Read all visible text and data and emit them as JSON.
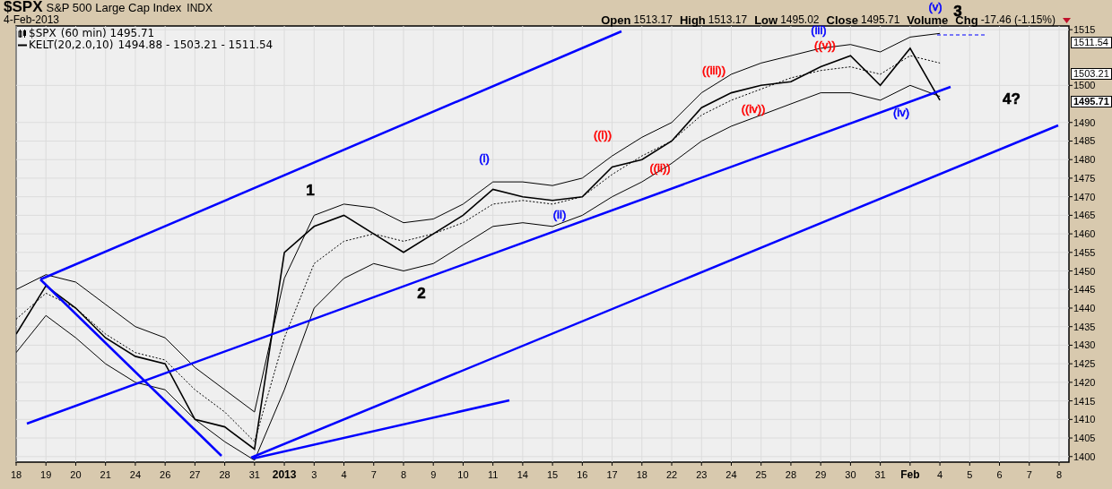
{
  "header": {
    "symbol": "$SPX",
    "name": "S&P 500 Large Cap Index",
    "exchange": "INDX",
    "date": "4-Feb-2013",
    "quote": [
      {
        "label": "Open",
        "value": "1513.17"
      },
      {
        "label": "High",
        "value": "1513.17"
      },
      {
        "label": "Low",
        "value": "1495.02"
      },
      {
        "label": "Close",
        "value": "1495.71"
      },
      {
        "label": "Volume"
      },
      {
        "label": "Chg",
        "value": "-17.46 (-1.15%)"
      }
    ]
  },
  "legend": [
    {
      "kind": "price",
      "text": "(60 min) 1495.71"
    },
    {
      "kind": "indicator",
      "text": "1494.88 - 1503.21 - 1511.54"
    }
  ],
  "price_tags": [
    {
      "text": "1511.54",
      "bold": false
    },
    {
      "text": "1503.21",
      "bold": false
    },
    {
      "text": "1495.71",
      "bold": true
    }
  ],
  "wave_labels": [
    {
      "text": "1",
      "color": "#000000"
    },
    {
      "text": "2",
      "color": "#000000"
    },
    {
      "text": "3",
      "color": "#000000"
    },
    {
      "text": "4?",
      "color": "#000000"
    },
    {
      "text": "(i)",
      "color": "#0000ff"
    },
    {
      "text": "(ii)",
      "color": "#0000ff"
    },
    {
      "text": "(iii)",
      "color": "#0000ff"
    },
    {
      "text": "(iv)",
      "color": "#0000ff"
    },
    {
      "text": "(v)",
      "color": "#0000ff"
    },
    {
      "text": "((i))",
      "color": "#ff0000"
    },
    {
      "text": "((ii))",
      "color": "#ff0000"
    },
    {
      "text": "((iii))",
      "color": "#ff0000"
    },
    {
      "text": "((iv))",
      "color": "#ff0000"
    },
    {
      "text": "((v))",
      "color": "#ff0000"
    }
  ],
  "chart_data": {
    "type": "line",
    "grid": true,
    "categories": [
      "18",
      "19",
      "20",
      "21",
      "24",
      "26",
      "27",
      "28",
      "31",
      "2013",
      "3",
      "4",
      "7",
      "8",
      "9",
      "10",
      "11",
      "14",
      "15",
      "16",
      "17",
      "18",
      "22",
      "23",
      "24",
      "25",
      "28",
      "29",
      "30",
      "31",
      "Feb",
      "4",
      "5",
      "6",
      "7",
      "8"
    ],
    "ylim": [
      1398.5,
      1516
    ],
    "yticks": [
      1400,
      1405,
      1410,
      1415,
      1420,
      1425,
      1430,
      1435,
      1440,
      1445,
      1450,
      1455,
      1460,
      1465,
      1470,
      1475,
      1480,
      1485,
      1490,
      1500,
      1515
    ],
    "series": [
      {
        "name": "$SPX",
        "color": "#000000",
        "line_style": "solid",
        "values": [
          1433,
          1446,
          1440,
          1432,
          1427,
          1425,
          1410,
          1408,
          1402,
          1455,
          1462,
          1465,
          1460,
          1455,
          1460,
          1465,
          1472,
          1470,
          1469,
          1470,
          1478,
          1480,
          1485,
          1494,
          1498,
          1500,
          1501,
          1505,
          1508,
          1500,
          1510,
          1496,
          null,
          null,
          null,
          null
        ]
      },
      {
        "name": "KELT(20,2.0,10)",
        "color": "#000000",
        "line_style": "dashed",
        "values": [
          1437,
          1444,
          1440,
          1433,
          1428,
          1426,
          1418,
          1412,
          1404,
          1432,
          1452,
          1458,
          1460,
          1458,
          1460,
          1463,
          1468,
          1469,
          1468,
          1470,
          1476,
          1481,
          1485,
          1492,
          1496,
          1499,
          1502,
          1504,
          1505,
          1503,
          1508,
          1506,
          null,
          null,
          null,
          null
        ]
      },
      {
        "color": "#000000",
        "line_style": "solid",
        "values": [
          1445,
          1449,
          1447,
          1441,
          1435,
          1432,
          1424,
          1418,
          1412,
          1448,
          1465,
          1468,
          1467,
          1463,
          1464,
          1468,
          1474,
          1474,
          1473,
          1475,
          1481,
          1486,
          1490,
          1498,
          1503,
          1506,
          1508,
          1510,
          1511,
          1509,
          1513,
          1514,
          null,
          null,
          null,
          null
        ]
      },
      {
        "color": "#000000",
        "line_style": "solid",
        "values": [
          1428,
          1438,
          1432,
          1425,
          1420,
          1418,
          1410,
          1404,
          1399,
          1418,
          1440,
          1448,
          1452,
          1450,
          1452,
          1457,
          1462,
          1463,
          1462,
          1465,
          1470,
          1474,
          1479,
          1485,
          1489,
          1492,
          1495,
          1498,
          1498,
          1496,
          1500,
          1497,
          null,
          null,
          null,
          null
        ]
      }
    ]
  }
}
